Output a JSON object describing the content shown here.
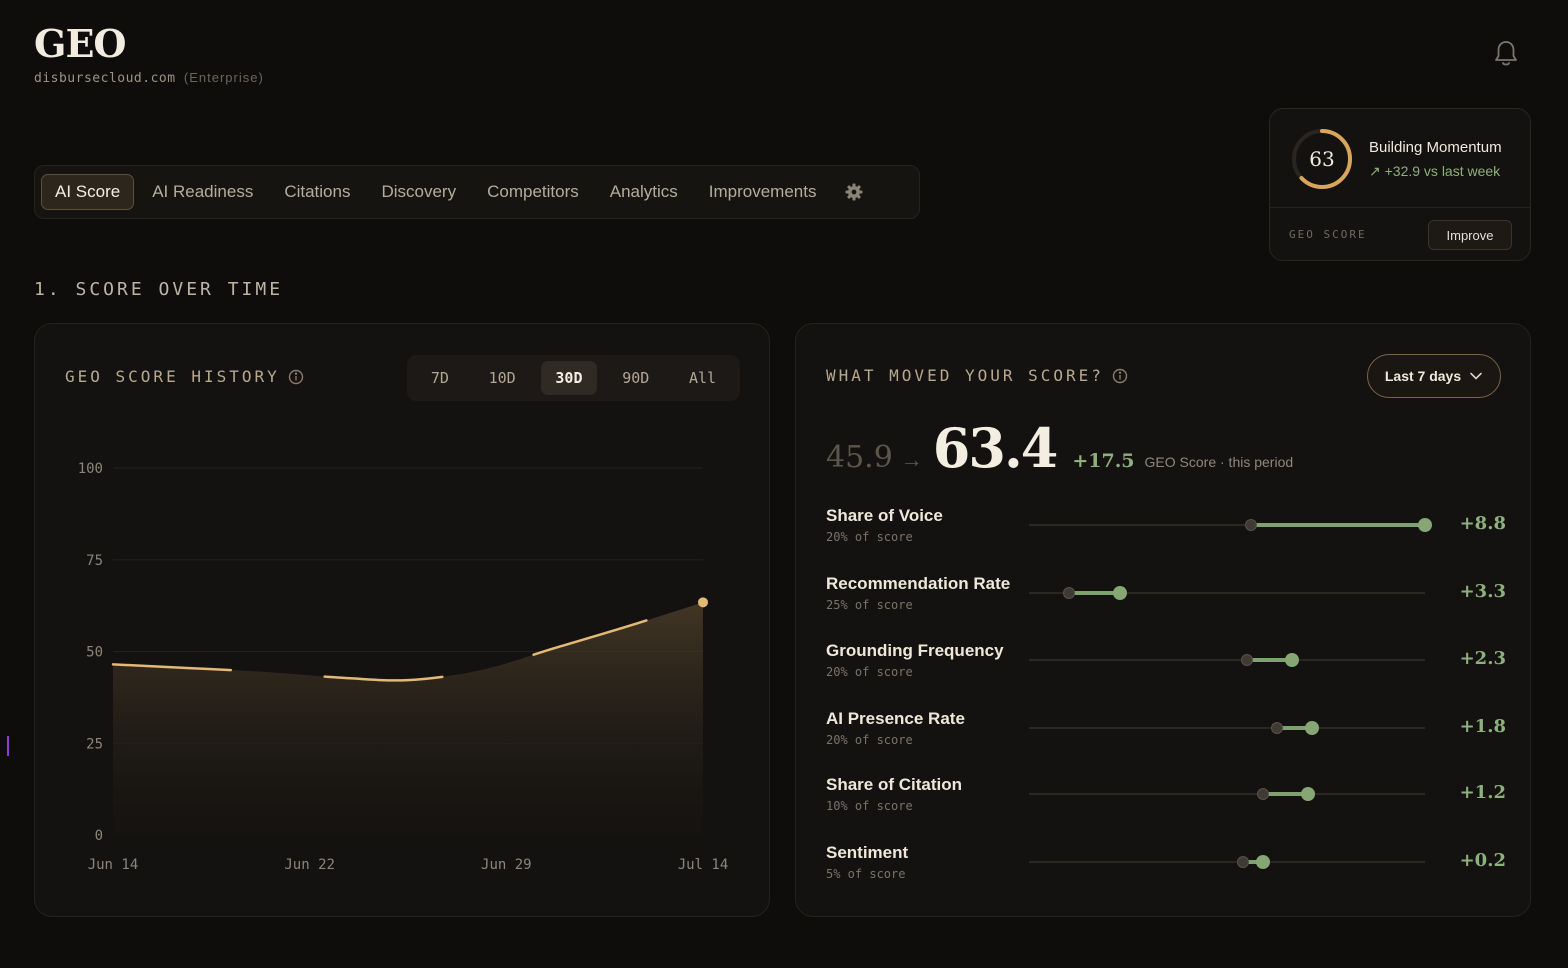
{
  "header": {
    "title": "GEO",
    "domain": "disbursecloud.com",
    "plan": "(Enterprise)"
  },
  "tabs": [
    {
      "label": "AI Score",
      "active": true
    },
    {
      "label": "AI Readiness"
    },
    {
      "label": "Citations"
    },
    {
      "label": "Discovery"
    },
    {
      "label": "Competitors"
    },
    {
      "label": "Analytics"
    },
    {
      "label": "Improvements"
    }
  ],
  "score_card": {
    "score": "63",
    "score_fraction": 0.63,
    "status": "Building Momentum",
    "delta": "↗ +32.9 vs last week",
    "label": "GEO SCORE",
    "improve_label": "Improve"
  },
  "section": {
    "heading": "1. SCORE OVER TIME"
  },
  "history": {
    "title": "GEO SCORE HISTORY",
    "ranges": [
      "7D",
      "10D",
      "30D",
      "90D",
      "All"
    ],
    "active_range": "30D"
  },
  "chart_data": {
    "type": "area",
    "title": "GEO SCORE HISTORY",
    "x_ticks": [
      "Jun 14",
      "Jun 22",
      "Jun 29",
      "Jul 14"
    ],
    "y_ticks": [
      0,
      25,
      50,
      75,
      100
    ],
    "ylim": [
      0,
      100
    ],
    "x": [
      "Jun 14",
      "Jun 18",
      "Jun 22",
      "Jun 26",
      "Jun 29",
      "Jul 3",
      "Jul 7",
      "Jul 10",
      "Jul 14"
    ],
    "values": [
      46.5,
      45.5,
      44.5,
      43,
      42.2,
      45,
      51,
      57,
      63.4
    ],
    "color": "#e2b976",
    "grid": true
  },
  "moves": {
    "title": "WHAT MOVED YOUR SCORE?",
    "period_label": "Last 7 days",
    "from": "45.9",
    "arrow": "→",
    "to": "63.4",
    "change": "+17.5",
    "caption": "GEO Score · this period",
    "factors": [
      {
        "name": "Share of Voice",
        "weight": "20% of score",
        "delta": "+8.8",
        "start": 0.56,
        "end": 1.0
      },
      {
        "name": "Recommendation Rate",
        "weight": "25% of score",
        "delta": "+3.3",
        "start": 0.1,
        "end": 0.23
      },
      {
        "name": "Grounding Frequency",
        "weight": "20% of score",
        "delta": "+2.3",
        "start": 0.55,
        "end": 0.665
      },
      {
        "name": "AI Presence Rate",
        "weight": "20% of score",
        "delta": "+1.8",
        "start": 0.625,
        "end": 0.715
      },
      {
        "name": "Share of Citation",
        "weight": "10% of score",
        "delta": "+1.2",
        "start": 0.59,
        "end": 0.705
      },
      {
        "name": "Sentiment",
        "weight": "5% of score",
        "delta": "+0.2",
        "start": 0.54,
        "end": 0.59
      }
    ]
  }
}
